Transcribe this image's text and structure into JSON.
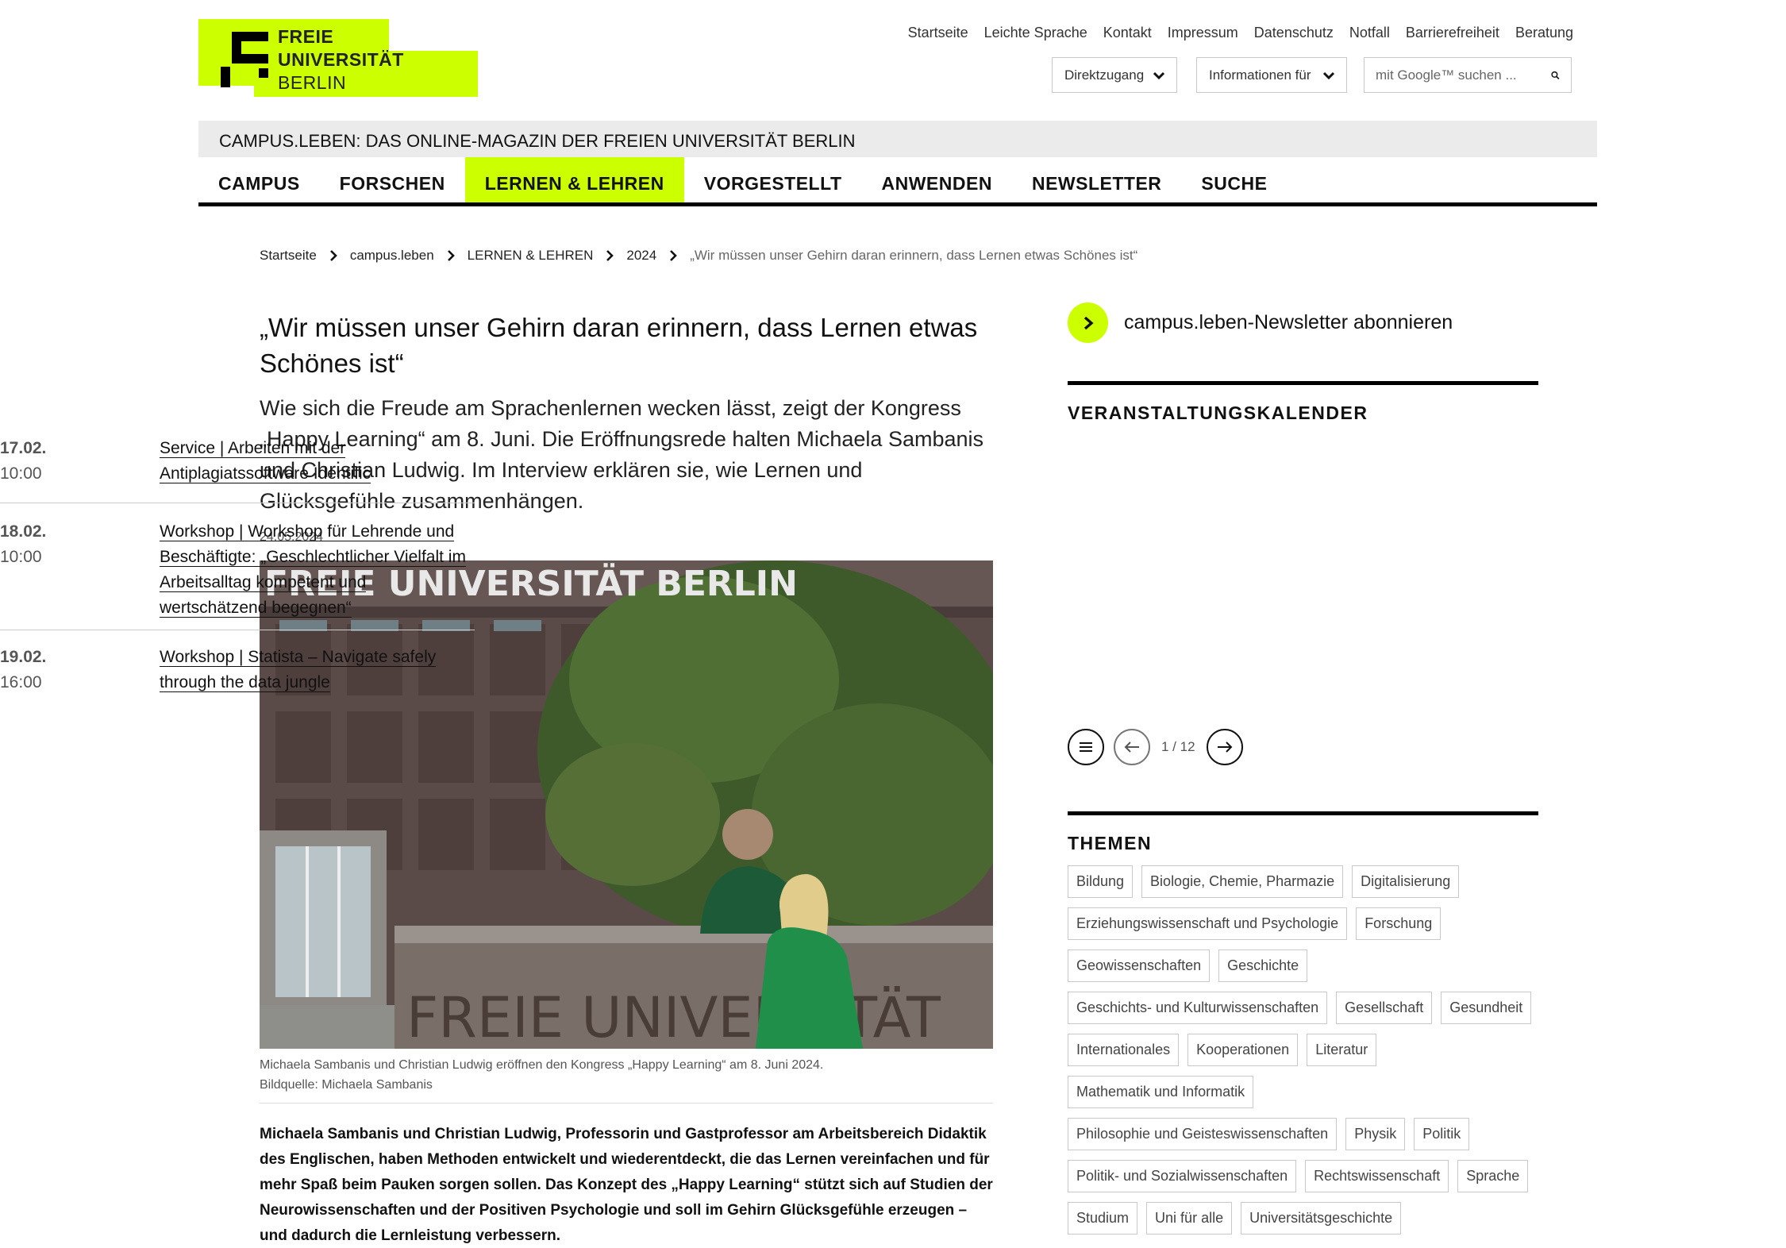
{
  "logo": {
    "line1": "FREIE",
    "line2": "UNIVERSITÄT",
    "line3": "BERLIN"
  },
  "service_nav": [
    "Startseite",
    "Leichte Sprache",
    "Kontakt",
    "Impressum",
    "Datenschutz",
    "Notfall",
    "Barrierefreiheit",
    "Beratung"
  ],
  "direktzugang": "Direktzugang",
  "informationen": "Informationen für",
  "search": {
    "placeholder": "mit Google™ suchen ..."
  },
  "magazine_title": "CAMPUS.LEBEN: DAS ONLINE-MAGAZIN DER FREIEN UNIVERSITÄT BERLIN",
  "main_nav": [
    "CAMPUS",
    "FORSCHEN",
    "LERNEN & LEHREN",
    "VORGESTELLT",
    "ANWENDEN",
    "NEWSLETTER",
    "SUCHE"
  ],
  "breadcrumb": [
    "Startseite",
    "campus.leben",
    "LERNEN & LEHREN",
    "2024",
    "„Wir müssen unser Gehirn daran erinnern, dass Lernen etwas Schönes ist“"
  ],
  "article": {
    "title": "„Wir müssen unser Gehirn daran erinnern, dass Lernen etwas Schönes ist“",
    "lead": "Wie sich die Freude am Sprachenlernen wecken lässt, zeigt der Kongress „Happy Learning“ am 8. Juni. Die Eröffnungsrede halten Michaela Sambanis und Christian Ludwig. Im Interview erklären sie, wie Lernen und Glücksgefühle zusammenhängen.",
    "date": "24.05.2024",
    "image_sign_top": "FREIE UNIVERSITÄT BERLIN",
    "image_sign_bottom": "FREIE UNIVERSITÄT",
    "caption": "Michaela Sambanis und Christian Ludwig eröffnen den Kongress „Happy Learning“ am 8. Juni 2024.",
    "credit": "Bildquelle: Michaela Sambanis",
    "body": "Michaela Sambanis und Christian Ludwig, Professorin und Gastprofessor am Arbeitsbereich Didaktik des Englischen, haben Methoden entwickelt und wiederentdeckt, die das Lernen vereinfachen und für mehr Spaß beim Pauken sorgen sollen. Das Konzept des „Happy Learning“ stützt sich auf Studien der Neurowissenschaften und der Positiven Psychologie und soll im Gehirn Glücksgefühle erzeugen – und dadurch die Lernleistung verbessern."
  },
  "newsletter": "campus.leben-Newsletter abonnieren",
  "calendar": {
    "title": "VERANSTALTUNGSKALENDER",
    "events": [
      {
        "date": "17.02.",
        "time": "10:00",
        "title": "Service | Arbeiten mit der Antiplagiatssoftware Identific"
      },
      {
        "date": "18.02.",
        "time": "10:00",
        "title": "Workshop | Workshop für Lehrende und Beschäftigte: „Geschlechtlicher Vielfalt im Arbeitsalltag kompetent und wertschätzend begegnen“"
      },
      {
        "date": "19.02.",
        "time": "16:00",
        "title": "Workshop | Statista – Navigate safely through the data jungle"
      }
    ],
    "pager": "1 / 12"
  },
  "themen": {
    "title": "THEMEN",
    "rows": [
      [
        "Bildung",
        "Biologie, Chemie, Pharmazie",
        "Digitalisierung"
      ],
      [
        "Erziehungswissenschaft und Psychologie",
        "Forschung"
      ],
      [
        "Geowissenschaften",
        "Geschichte"
      ],
      [
        "Geschichts- und Kulturwissenschaften",
        "Gesellschaft",
        "Gesundheit"
      ],
      [
        "Internationales",
        "Kooperationen",
        "Literatur"
      ],
      [
        "Mathematik und Informatik"
      ],
      [
        "Philosophie und Geisteswissenschaften",
        "Physik",
        "Politik"
      ],
      [
        "Politik- und Sozialwissenschaften",
        "Rechtswissenschaft",
        "Sprache"
      ],
      [
        "Studium",
        "Uni für alle",
        "Universitätsgeschichte"
      ]
    ]
  },
  "colors": {
    "accent": "#ccff00",
    "text": "#111111",
    "muted": "#555555",
    "border": "#c9c9c9",
    "bar": "#ebebeb"
  }
}
